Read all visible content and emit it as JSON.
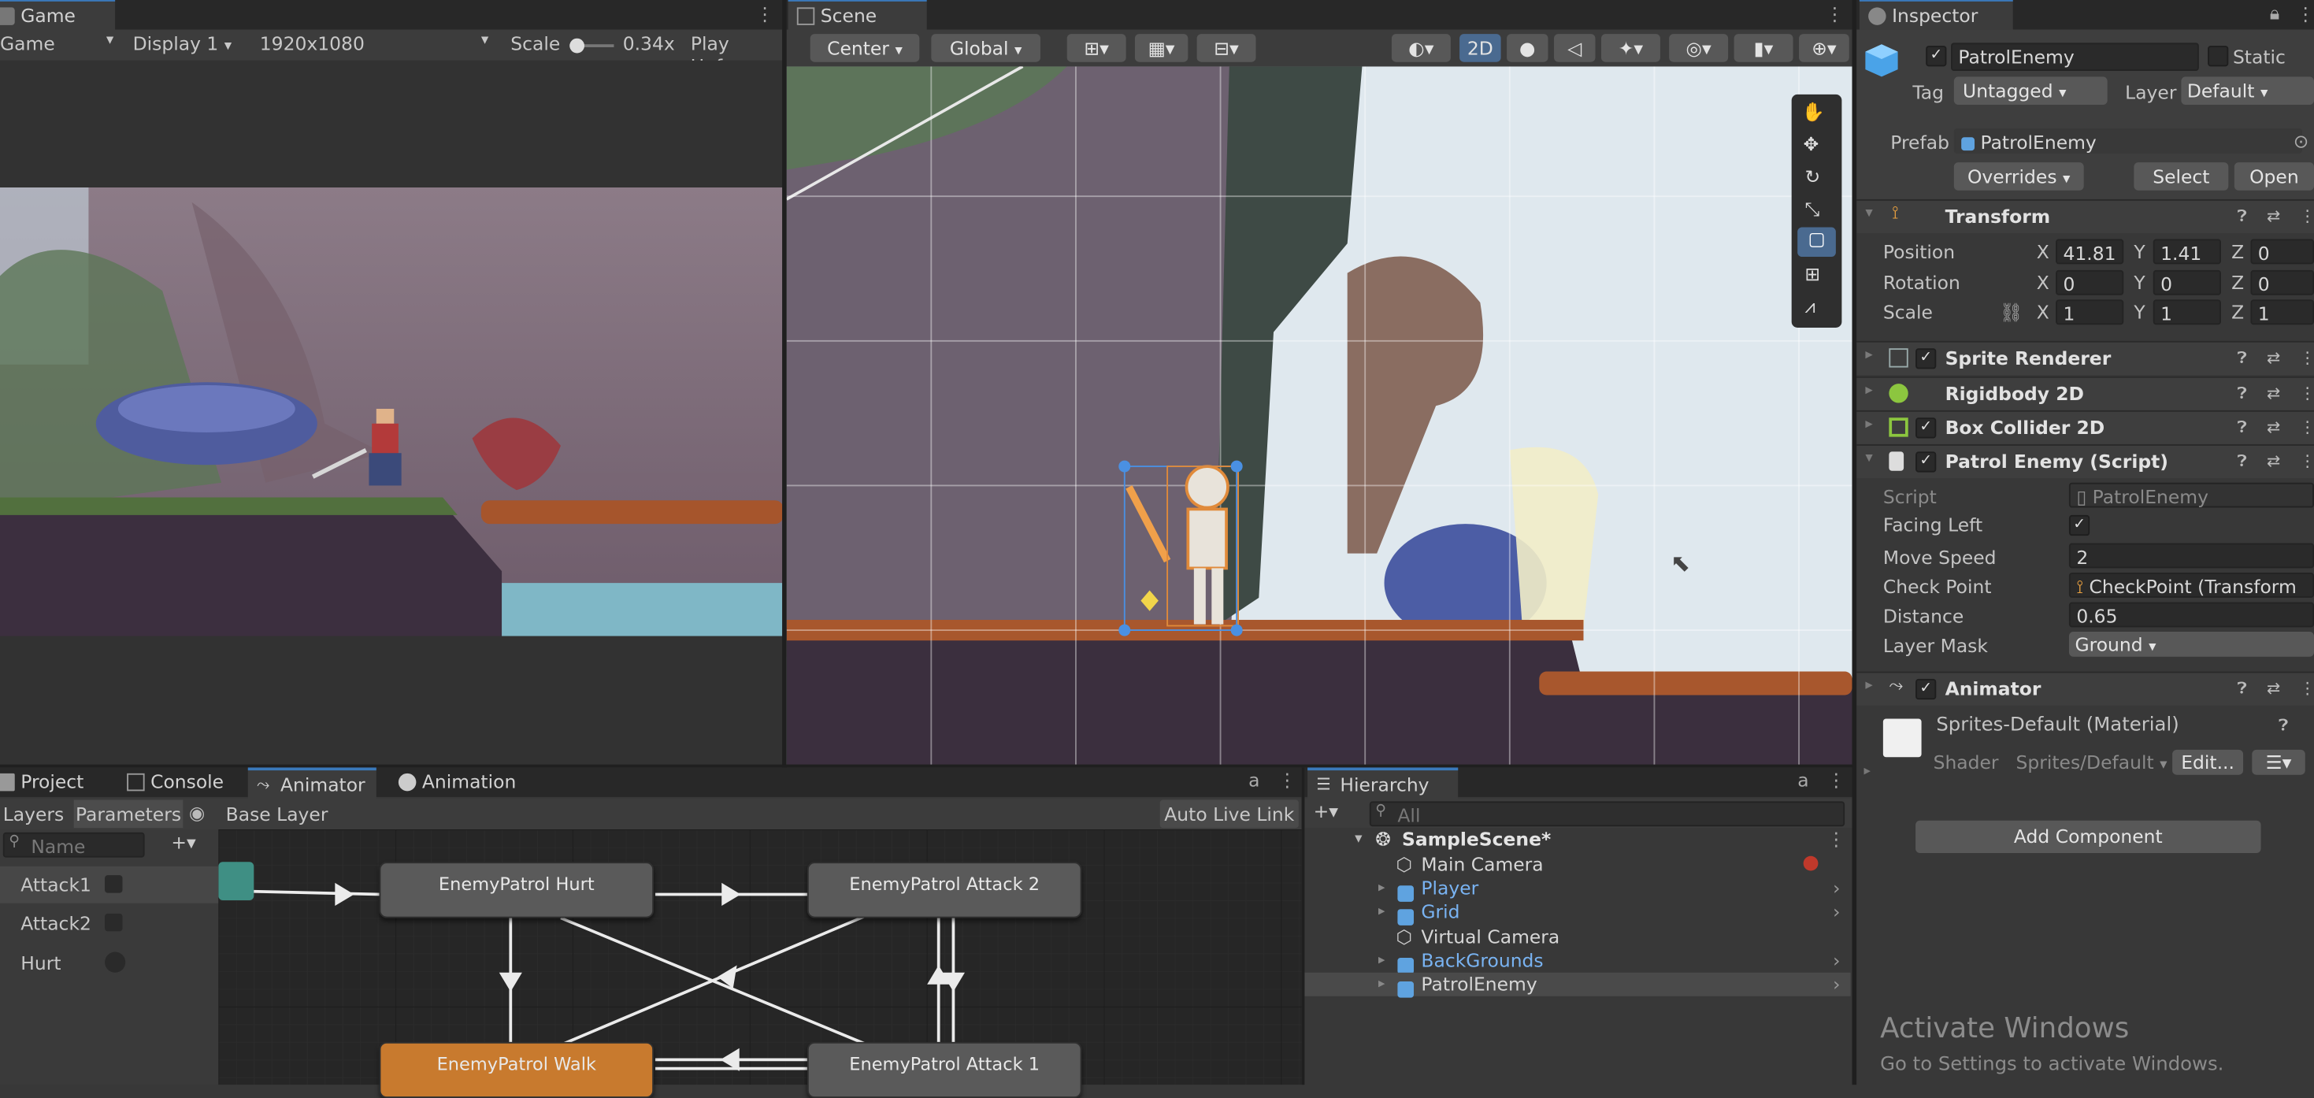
{
  "game": {
    "tab": "Game",
    "mode": "Game",
    "display": "Display 1",
    "resolution": "1920x1080",
    "scale_label": "Scale",
    "scale_value": "0.34x",
    "play_label": "Play Unfoc"
  },
  "scene": {
    "tab": "Scene",
    "pivot": "Center",
    "space": "Global",
    "mode_2d": "2D"
  },
  "inspector": {
    "tab": "Inspector",
    "object_name": "PatrolEnemy",
    "static_label": "Static",
    "tag_label": "Tag",
    "tag_value": "Untagged",
    "layer_label": "Layer",
    "layer_value": "Default",
    "prefab_label": "Prefab",
    "prefab_value": "PatrolEnemy",
    "overrides": "Overrides",
    "select": "Select",
    "open": "Open",
    "transform": {
      "title": "Transform",
      "position_label": "Position",
      "rotation_label": "Rotation",
      "scale_label": "Scale",
      "x": "X",
      "y": "Y",
      "z": "Z",
      "pos": [
        "41.81",
        "1.41",
        "0"
      ],
      "rot": [
        "0",
        "0",
        "0"
      ],
      "scl": [
        "1",
        "1",
        "1"
      ]
    },
    "components": [
      "Sprite Renderer",
      "Rigidbody 2D",
      "Box Collider 2D",
      "Patrol Enemy (Script)",
      "Animator"
    ],
    "script": {
      "script_label": "Script",
      "script_value": "PatrolEnemy",
      "facing_left_label": "Facing Left",
      "move_speed_label": "Move Speed",
      "move_speed_value": "2",
      "check_point_label": "Check Point",
      "check_point_value": "CheckPoint (Transform",
      "distance_label": "Distance",
      "distance_value": "0.65",
      "layer_mask_label": "Layer Mask",
      "layer_mask_value": "Ground"
    },
    "material": {
      "name": "Sprites-Default (Material)",
      "shader_label": "Shader",
      "shader_value": "Sprites/Default",
      "edit": "Edit..."
    },
    "add_component": "Add Component",
    "watermark_title": "Activate Windows",
    "watermark_sub": "Go to Settings to activate Windows."
  },
  "bottom_tabs": [
    "Project",
    "Console",
    "Animator",
    "Animation"
  ],
  "animator": {
    "layers": "Layers",
    "parameters": "Parameters",
    "base_layer": "Base Layer",
    "auto_live_link": "Auto Live Link",
    "search_placeholder": "Name",
    "params": [
      {
        "name": "Attack1",
        "kind": "trigger"
      },
      {
        "name": "Attack2",
        "kind": "trigger"
      },
      {
        "name": "Hurt",
        "kind": "bool"
      }
    ],
    "states": [
      "EnemyPatrol Hurt",
      "EnemyPatrol Attack 2",
      "EnemyPatrol Walk",
      "EnemyPatrol Attack 1"
    ]
  },
  "hierarchy": {
    "tab": "Hierarchy",
    "search_placeholder": "All",
    "scene": "SampleScene*",
    "items": [
      {
        "name": "Main Camera",
        "prefab": false
      },
      {
        "name": "Player",
        "prefab": true
      },
      {
        "name": "Grid",
        "prefab": true
      },
      {
        "name": "Virtual Camera",
        "prefab": false
      },
      {
        "name": "BackGrounds",
        "prefab": true
      },
      {
        "name": "PatrolEnemy",
        "prefab": true
      }
    ]
  }
}
